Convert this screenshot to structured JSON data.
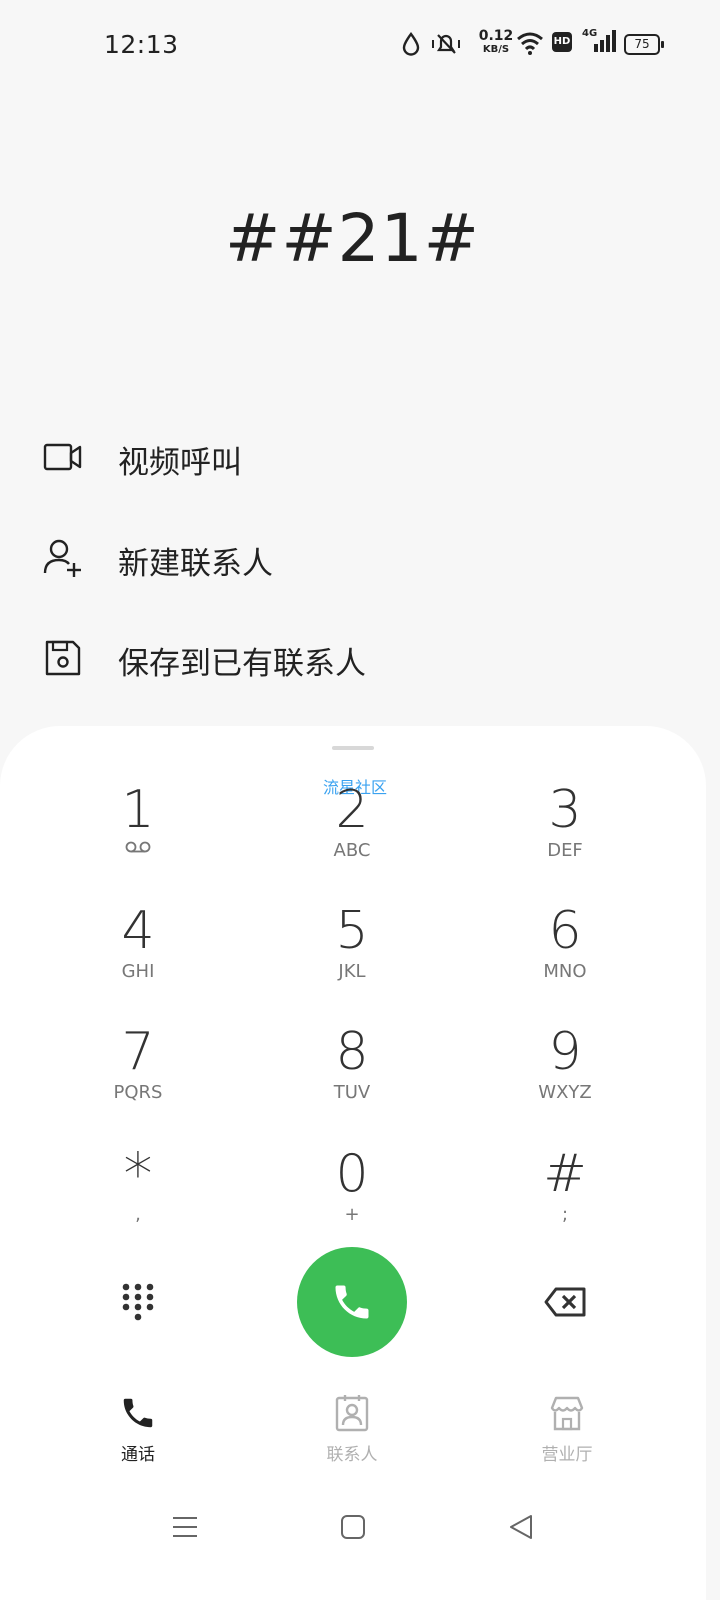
{
  "status_bar": {
    "time": "12:13",
    "net_speed_value": "0.12",
    "net_speed_unit": "KB/S",
    "hd_label": "HD",
    "signal_label": "4G",
    "battery": "75"
  },
  "dialed_number": "##21#",
  "actions": [
    {
      "label": "视频呼叫",
      "icon": "video-call-icon"
    },
    {
      "label": "新建联系人",
      "icon": "add-contact-icon"
    },
    {
      "label": "保存到已有联系人",
      "icon": "save-icon"
    }
  ],
  "operator_label": "流星社区",
  "keypad": [
    {
      "digit": "1",
      "sub": ""
    },
    {
      "digit": "2",
      "sub": "ABC"
    },
    {
      "digit": "3",
      "sub": "DEF"
    },
    {
      "digit": "4",
      "sub": "GHI"
    },
    {
      "digit": "5",
      "sub": "JKL"
    },
    {
      "digit": "6",
      "sub": "MNO"
    },
    {
      "digit": "7",
      "sub": "PQRS"
    },
    {
      "digit": "8",
      "sub": "TUV"
    },
    {
      "digit": "9",
      "sub": "WXYZ"
    },
    {
      "digit": "*",
      "sub": ","
    },
    {
      "digit": "0",
      "sub": "+"
    },
    {
      "digit": "#",
      "sub": ";"
    }
  ],
  "tabs": [
    {
      "label": "通话",
      "icon": "phone-icon",
      "active": true
    },
    {
      "label": "联系人",
      "icon": "contacts-icon",
      "active": false
    },
    {
      "label": "营业厅",
      "icon": "store-icon",
      "active": false
    }
  ],
  "colors": {
    "call_green": "#3dbe56",
    "operator_blue": "#3aa2f0",
    "inactive_tab": "#b0b0b0",
    "active_tab": "#222222"
  }
}
